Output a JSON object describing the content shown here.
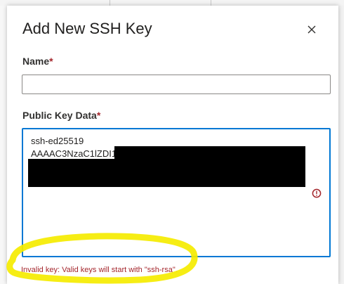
{
  "dialog": {
    "title": "Add New SSH Key",
    "close_icon": "close-icon"
  },
  "name_field": {
    "label": "Name",
    "required_mark": "*",
    "value": ""
  },
  "key_field": {
    "label": "Public Key Data",
    "required_mark": "*",
    "value": "ssh-ed25519\nAAAAC3NzaC1lZDI1",
    "error_icon": "error-circle-icon",
    "error_message": "Invalid key: Valid keys will start with \"ssh-rsa\"."
  },
  "colors": {
    "accent": "#0078d4",
    "error": "#a4262c",
    "highlight": "#f5ec00"
  }
}
